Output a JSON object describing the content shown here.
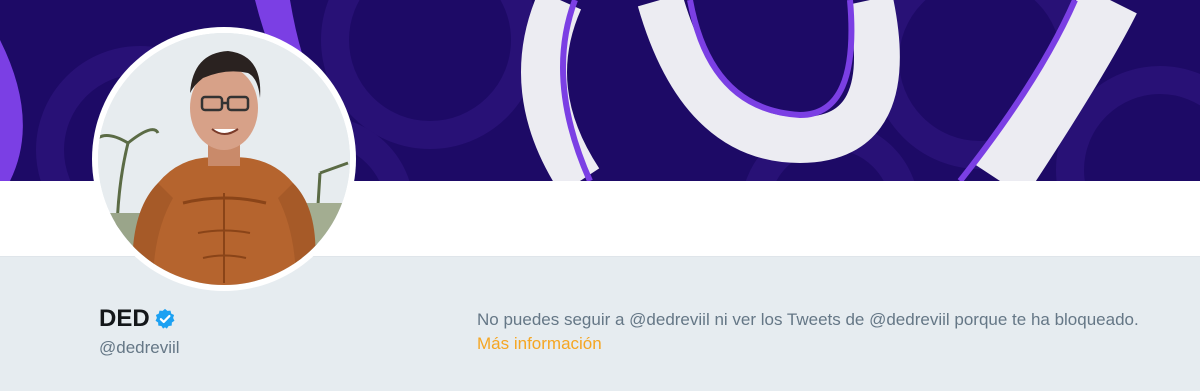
{
  "profile": {
    "display_name": "DED",
    "screen_name": "@dedreviil",
    "verified": true
  },
  "blocked_notice": {
    "message": "No puedes seguir a @dedreviil ni ver los Tweets de @dedreviil porque te ha bloqueado.",
    "link_label": "Más información"
  },
  "colors": {
    "banner_background": "#1d0a66",
    "banner_accent": "#7b3fe4",
    "link": "#f5a623",
    "verified": "#1da1f2"
  },
  "icons": {
    "verified": "verified-badge-icon"
  }
}
